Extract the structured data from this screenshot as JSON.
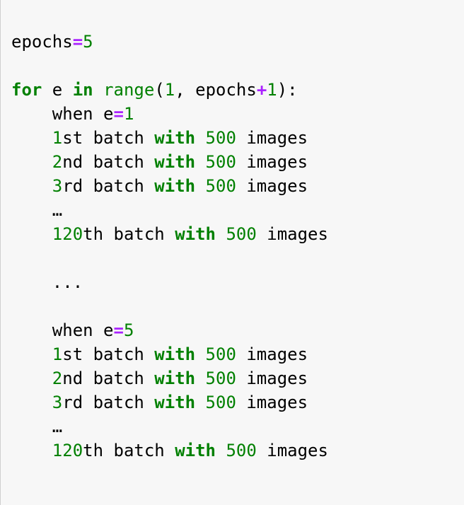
{
  "theme": {
    "background": "#f7f7f7",
    "keyword": "#008000",
    "number": "#008000",
    "operator": "#aa22ff",
    "text": "#000000"
  },
  "code_lines": [
    [
      {
        "t": "epochs",
        "c": "txt"
      },
      {
        "t": "=",
        "c": "op"
      },
      {
        "t": "5",
        "c": "num"
      }
    ],
    [],
    [
      {
        "t": "for",
        "c": "kw"
      },
      {
        "t": " e ",
        "c": "txt"
      },
      {
        "t": "in",
        "c": "kw"
      },
      {
        "t": " ",
        "c": "txt"
      },
      {
        "t": "range",
        "c": "bi"
      },
      {
        "t": "(",
        "c": "txt"
      },
      {
        "t": "1",
        "c": "num"
      },
      {
        "t": ", epochs",
        "c": "txt"
      },
      {
        "t": "+",
        "c": "op"
      },
      {
        "t": "1",
        "c": "num"
      },
      {
        "t": "):",
        "c": "txt"
      }
    ],
    [
      {
        "t": "    when e",
        "c": "txt"
      },
      {
        "t": "=",
        "c": "op"
      },
      {
        "t": "1",
        "c": "num"
      }
    ],
    [
      {
        "t": "    ",
        "c": "txt"
      },
      {
        "t": "1",
        "c": "num"
      },
      {
        "t": "st batch ",
        "c": "txt"
      },
      {
        "t": "with",
        "c": "kw"
      },
      {
        "t": " ",
        "c": "txt"
      },
      {
        "t": "500",
        "c": "num"
      },
      {
        "t": " images",
        "c": "txt"
      }
    ],
    [
      {
        "t": "    ",
        "c": "txt"
      },
      {
        "t": "2",
        "c": "num"
      },
      {
        "t": "nd batch ",
        "c": "txt"
      },
      {
        "t": "with",
        "c": "kw"
      },
      {
        "t": " ",
        "c": "txt"
      },
      {
        "t": "500",
        "c": "num"
      },
      {
        "t": " images",
        "c": "txt"
      }
    ],
    [
      {
        "t": "    ",
        "c": "txt"
      },
      {
        "t": "3",
        "c": "num"
      },
      {
        "t": "rd batch ",
        "c": "txt"
      },
      {
        "t": "with",
        "c": "kw"
      },
      {
        "t": " ",
        "c": "txt"
      },
      {
        "t": "500",
        "c": "num"
      },
      {
        "t": " images",
        "c": "txt"
      }
    ],
    [
      {
        "t": "    …",
        "c": "txt"
      }
    ],
    [
      {
        "t": "    ",
        "c": "txt"
      },
      {
        "t": "120",
        "c": "num"
      },
      {
        "t": "th batch ",
        "c": "txt"
      },
      {
        "t": "with",
        "c": "kw"
      },
      {
        "t": " ",
        "c": "txt"
      },
      {
        "t": "500",
        "c": "num"
      },
      {
        "t": " images",
        "c": "txt"
      }
    ],
    [],
    [
      {
        "t": "    ...",
        "c": "txt"
      }
    ],
    [],
    [
      {
        "t": "    when e",
        "c": "txt"
      },
      {
        "t": "=",
        "c": "op"
      },
      {
        "t": "5",
        "c": "num"
      }
    ],
    [
      {
        "t": "    ",
        "c": "txt"
      },
      {
        "t": "1",
        "c": "num"
      },
      {
        "t": "st batch ",
        "c": "txt"
      },
      {
        "t": "with",
        "c": "kw"
      },
      {
        "t": " ",
        "c": "txt"
      },
      {
        "t": "500",
        "c": "num"
      },
      {
        "t": " images",
        "c": "txt"
      }
    ],
    [
      {
        "t": "    ",
        "c": "txt"
      },
      {
        "t": "2",
        "c": "num"
      },
      {
        "t": "nd batch ",
        "c": "txt"
      },
      {
        "t": "with",
        "c": "kw"
      },
      {
        "t": " ",
        "c": "txt"
      },
      {
        "t": "500",
        "c": "num"
      },
      {
        "t": " images",
        "c": "txt"
      }
    ],
    [
      {
        "t": "    ",
        "c": "txt"
      },
      {
        "t": "3",
        "c": "num"
      },
      {
        "t": "rd batch ",
        "c": "txt"
      },
      {
        "t": "with",
        "c": "kw"
      },
      {
        "t": " ",
        "c": "txt"
      },
      {
        "t": "500",
        "c": "num"
      },
      {
        "t": " images",
        "c": "txt"
      }
    ],
    [
      {
        "t": "    …",
        "c": "txt"
      }
    ],
    [
      {
        "t": "    ",
        "c": "txt"
      },
      {
        "t": "120",
        "c": "num"
      },
      {
        "t": "th batch ",
        "c": "txt"
      },
      {
        "t": "with",
        "c": "kw"
      },
      {
        "t": " ",
        "c": "txt"
      },
      {
        "t": "500",
        "c": "num"
      },
      {
        "t": " images",
        "c": "txt"
      }
    ]
  ]
}
